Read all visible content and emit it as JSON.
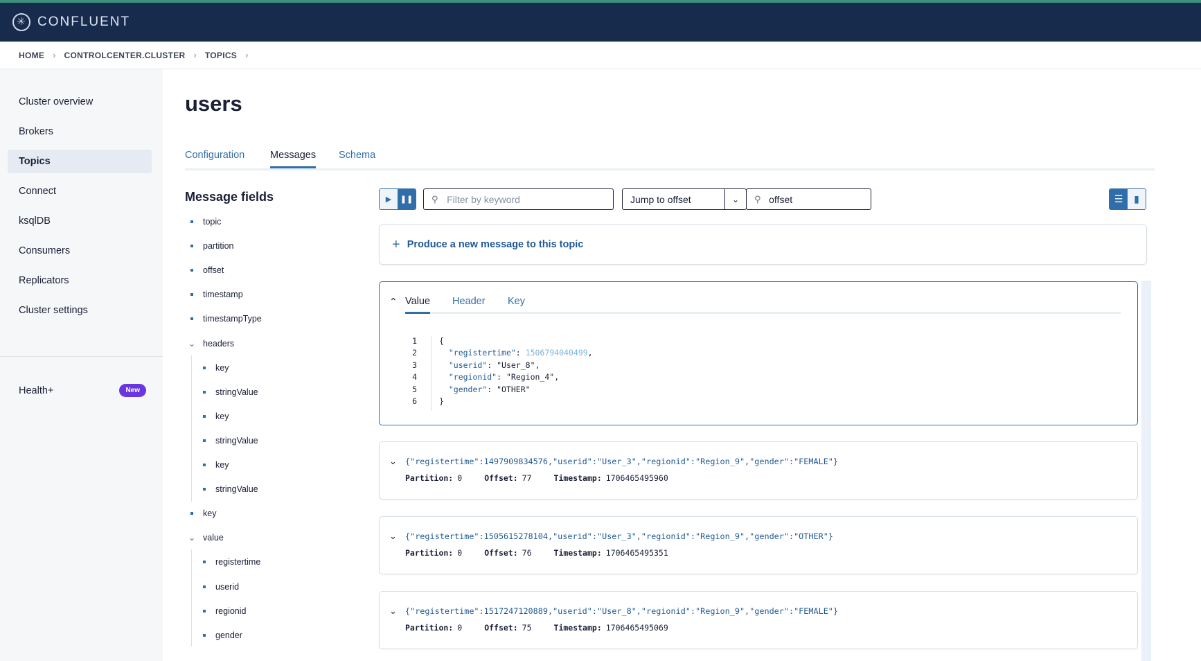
{
  "app": {
    "logo_text": "CONFLUENT",
    "accent": "#2f6ea8",
    "topbar_color": "#172b4d"
  },
  "breadcrumb": [
    "HOME",
    "CONTROLCENTER.CLUSTER",
    "TOPICS"
  ],
  "sidebar": {
    "items": [
      {
        "label": "Cluster overview",
        "active": false
      },
      {
        "label": "Brokers",
        "active": false
      },
      {
        "label": "Topics",
        "active": true
      },
      {
        "label": "Connect",
        "active": false
      },
      {
        "label": "ksqlDB",
        "active": false
      },
      {
        "label": "Consumers",
        "active": false
      },
      {
        "label": "Replicators",
        "active": false
      },
      {
        "label": "Cluster settings",
        "active": false
      }
    ],
    "health": {
      "label": "Health+",
      "badge": "New"
    }
  },
  "page": {
    "title": "users",
    "tabs": [
      {
        "label": "Configuration",
        "active": false
      },
      {
        "label": "Messages",
        "active": true
      },
      {
        "label": "Schema",
        "active": false
      }
    ]
  },
  "message_fields": {
    "title": "Message fields",
    "fields": [
      {
        "label": "topic",
        "level": 0,
        "type": "bullet"
      },
      {
        "label": "partition",
        "level": 0,
        "type": "bullet"
      },
      {
        "label": "offset",
        "level": 0,
        "type": "bullet"
      },
      {
        "label": "timestamp",
        "level": 0,
        "type": "bullet"
      },
      {
        "label": "timestampType",
        "level": 0,
        "type": "bullet"
      },
      {
        "label": "headers",
        "level": 0,
        "type": "expanded"
      },
      {
        "label": "key",
        "level": 1,
        "type": "bullet"
      },
      {
        "label": "stringValue",
        "level": 1,
        "type": "bullet"
      },
      {
        "label": "key",
        "level": 1,
        "type": "bullet"
      },
      {
        "label": "stringValue",
        "level": 1,
        "type": "bullet"
      },
      {
        "label": "key",
        "level": 1,
        "type": "bullet"
      },
      {
        "label": "stringValue",
        "level": 1,
        "type": "bullet"
      },
      {
        "label": "key",
        "level": 0,
        "type": "bullet"
      },
      {
        "label": "value",
        "level": 0,
        "type": "expanded"
      },
      {
        "label": "registertime",
        "level": 1,
        "type": "bullet"
      },
      {
        "label": "userid",
        "level": 1,
        "type": "bullet"
      },
      {
        "label": "regionid",
        "level": 1,
        "type": "bullet"
      },
      {
        "label": "gender",
        "level": 1,
        "type": "bullet"
      }
    ]
  },
  "toolbar": {
    "filter_placeholder": "Filter by keyword",
    "jump_label": "Jump to offset",
    "offset_value": "offset"
  },
  "produce": {
    "label": "Produce a new message to this topic"
  },
  "expanded_message": {
    "tabs": [
      {
        "label": "Value",
        "active": true
      },
      {
        "label": "Header",
        "active": false
      },
      {
        "label": "Key",
        "active": false
      }
    ],
    "lines": [
      {
        "n": "1",
        "text": "{"
      },
      {
        "n": "2",
        "key": "\"registertime\"",
        "num": "1506794040499",
        "tail": ","
      },
      {
        "n": "3",
        "key": "\"userid\"",
        "str": "\"User_8\"",
        "tail": ","
      },
      {
        "n": "4",
        "key": "\"regionid\"",
        "str": "\"Region_4\"",
        "tail": ","
      },
      {
        "n": "5",
        "key": "\"gender\"",
        "str": "\"OTHER\"",
        "tail": ""
      },
      {
        "n": "6",
        "text": "}"
      }
    ]
  },
  "messages": [
    {
      "json": "{\"registertime\":1497909834576,\"userid\":\"User_3\",\"regionid\":\"Region_9\",\"gender\":\"FEMALE\"}",
      "partition_label": "Partition:",
      "partition": "0",
      "offset_label": "Offset:",
      "offset": "77",
      "timestamp_label": "Timestamp:",
      "timestamp": "1706465495960"
    },
    {
      "json": "{\"registertime\":1505615278104,\"userid\":\"User_3\",\"regionid\":\"Region_9\",\"gender\":\"OTHER\"}",
      "partition_label": "Partition:",
      "partition": "0",
      "offset_label": "Offset:",
      "offset": "76",
      "timestamp_label": "Timestamp:",
      "timestamp": "1706465495351"
    },
    {
      "json": "{\"registertime\":1517247120889,\"userid\":\"User_8\",\"regionid\":\"Region_9\",\"gender\":\"FEMALE\"}",
      "partition_label": "Partition:",
      "partition": "0",
      "offset_label": "Offset:",
      "offset": "75",
      "timestamp_label": "Timestamp:",
      "timestamp": "1706465495069"
    }
  ]
}
